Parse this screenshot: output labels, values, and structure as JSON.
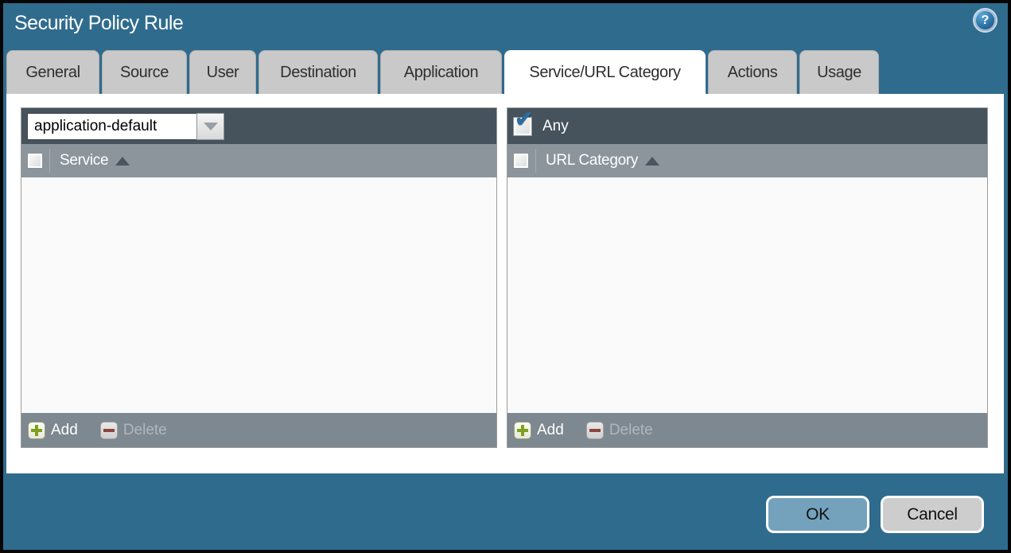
{
  "window": {
    "title": "Security Policy Rule"
  },
  "tabs": [
    {
      "label": "General",
      "active": false
    },
    {
      "label": "Source",
      "active": false
    },
    {
      "label": "User",
      "active": false
    },
    {
      "label": "Destination",
      "active": false
    },
    {
      "label": "Application",
      "active": false
    },
    {
      "label": "Service/URL Category",
      "active": true
    },
    {
      "label": "Actions",
      "active": false
    },
    {
      "label": "Usage",
      "active": false
    }
  ],
  "service_panel": {
    "service_mode_value": "application-default",
    "column_header": "Service",
    "header_checkbox_checked": false,
    "rows": [],
    "add_label": "Add",
    "delete_label": "Delete",
    "delete_enabled": false
  },
  "url_category_panel": {
    "any_label": "Any",
    "any_checked": true,
    "column_header": "URL Category",
    "header_checkbox_checked": false,
    "rows": [],
    "add_label": "Add",
    "delete_label": "Delete",
    "delete_enabled": false
  },
  "dialog_buttons": {
    "ok": "OK",
    "cancel": "Cancel"
  },
  "icons": {
    "help": "?",
    "add_plus": "+",
    "delete_minus": "−",
    "checkmark": "✔"
  },
  "colors": {
    "background_teal": "#2F6B8D",
    "panel_header_dark": "#46535D",
    "column_header_gray": "#8C959C",
    "footer_gray": "#7E8890",
    "tab_inactive": "#C9C9C9",
    "tab_active": "#FFFFFF",
    "ok_button": "#74A2BC",
    "cancel_button": "#CDCDCD",
    "add_icon_green": "#7FA01E",
    "delete_icon_red": "#8F4440",
    "checkmark_blue": "#2B6DA0"
  }
}
